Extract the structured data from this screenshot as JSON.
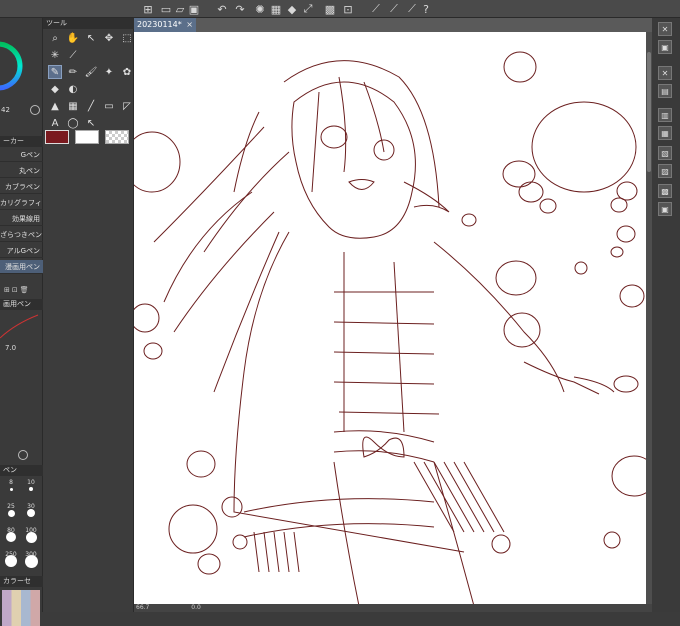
{
  "document": {
    "tab_title": "20230114*",
    "close_glyph": "×"
  },
  "tool_panel": {
    "title": "ツール"
  },
  "brush_panel": {
    "title": "ーカー",
    "items": [
      "Gペン",
      "丸ペン",
      "カブラペン",
      "カリグラフィ",
      "効果線用",
      "ざらつきペン",
      "アルGペン",
      "漫画用ペン"
    ],
    "active_index": 7
  },
  "brush_size_panel": {
    "title": "ペン",
    "sizes": [
      "8",
      "10",
      "25",
      "30",
      "80",
      "100",
      "250",
      "300"
    ]
  },
  "color_set_panel": {
    "title": "カラーセ"
  },
  "left_panel": {
    "color_readout": "42",
    "thickness_value": "7.0",
    "pen_label": "画用ペン"
  },
  "status_bar": {
    "zoom": "66.7",
    "angle": "0.0"
  },
  "colors": {
    "main_color": "#7a1a1f",
    "sub_color": "#ffffff",
    "line_color": "#6b1f1f"
  },
  "top_toolbar": {
    "icons": [
      "canvas-icon",
      "save-icon",
      "open-icon",
      "undo-icon",
      "redo-icon",
      "select-icon",
      "transform-icon",
      "clear-icon",
      "ruler-icon",
      "help-icon"
    ]
  }
}
